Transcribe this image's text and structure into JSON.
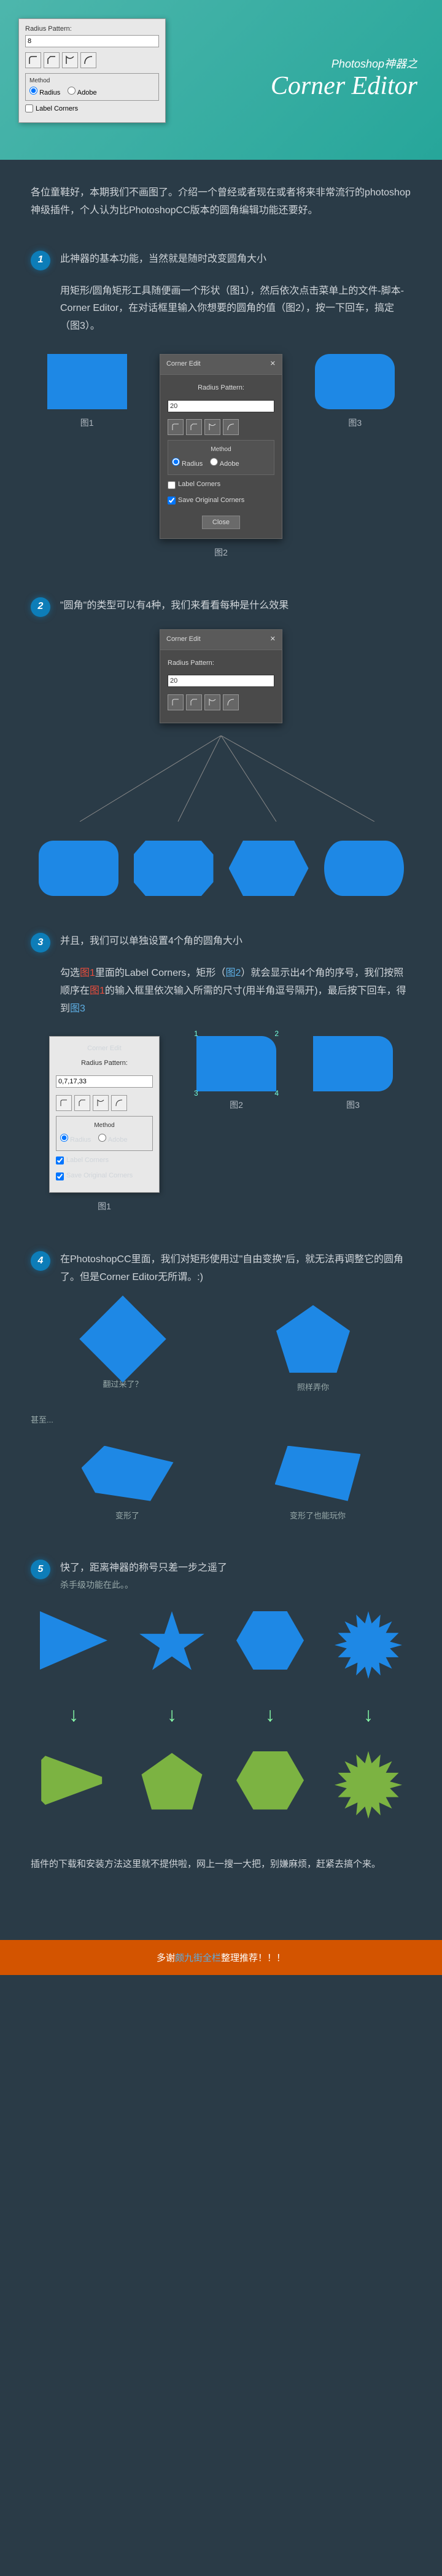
{
  "header": {
    "sub": "Photoshop神器之",
    "main": "Corner Editor"
  },
  "panel": {
    "radiusLabel": "Radius Pattern:",
    "radiusValue": "8",
    "methodLabel": "Method",
    "radiusOpt": "Radius",
    "adobeOpt": "Adobe",
    "labelCorners": "Label Corners",
    "saveOriginal": "Save Original Corners",
    "title": "Corner Edit",
    "close": "Close",
    "value20": "20",
    "valueMulti": "0,7,17,33"
  },
  "intro": "各位童鞋好，本期我们不画图了。介绍一个曾经或者现在或者将来非常流行的photoshop神级插件，个人认为比PhotoshopCC版本的圆角编辑功能还要好。",
  "s1": {
    "num": "1",
    "title": "此神器的基本功能，当然就是随时改变圆角大小",
    "body": "用矩形/圆角矩形工具随便画一个形状（图1），然后依次点击菜单上的文件-脚本-Corner Editor，在对话框里输入你想要的圆角的值（图2），按一下回车，搞定（图3）。"
  },
  "s2": {
    "num": "2",
    "title": "\"圆角\"的类型可以有4种，我们来看看每种是什么效果"
  },
  "s3": {
    "num": "3",
    "title": "并且，我们可以单独设置4个角的圆角大小",
    "body": "勾选图1里面的Label Corners，矩形（图2）就会显示出4个角的序号，我们按照顺序在图1的输入框里依次输入所需的尺寸(用半角逗号隔开)，最后按下回车，得到图3"
  },
  "s4": {
    "num": "4",
    "title": "在PhotoshopCC里面，我们对矩形使用过\"自由变换\"后，就无法再调整它的圆角了。但是Corner Editor无所谓。:)"
  },
  "s5": {
    "num": "5",
    "title": "快了，距离神器的称号只差一步之遥了",
    "sub": "杀手级功能在此。。"
  },
  "labels": {
    "fig1": "图1",
    "fig2": "图2",
    "fig3": "图3",
    "q1": "翻过来了？",
    "q2": "照样弄你",
    "q3": "甚至...",
    "q4": "变形了",
    "q5": "变形了也能玩你"
  },
  "footer": {
    "text": "插件的下载和安装方法这里就不提供啦，网上一搜一大把，别嫌麻烦，赶紧去搞个来。",
    "bar1": "多谢",
    "barLink": "颇九街全栏",
    "bar2": "整理推荐！！！"
  }
}
